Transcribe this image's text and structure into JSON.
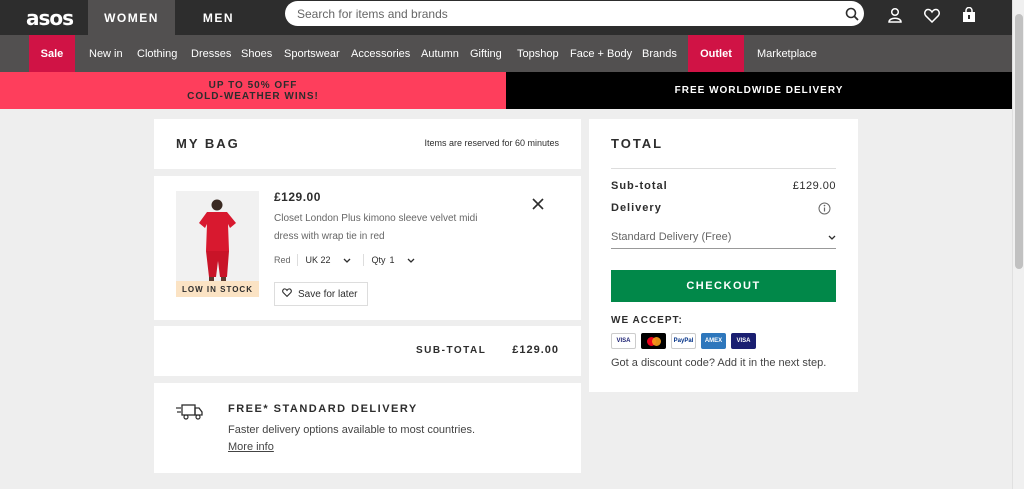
{
  "header": {
    "logo": "asos",
    "tabs": [
      {
        "label": "WOMEN"
      },
      {
        "label": "MEN"
      }
    ],
    "search": {
      "placeholder": "Search for items and brands"
    }
  },
  "nav": {
    "items": [
      {
        "label": "Sale",
        "highlight": true
      },
      {
        "label": "New in"
      },
      {
        "label": "Clothing"
      },
      {
        "label": "Dresses"
      },
      {
        "label": "Shoes"
      },
      {
        "label": "Sportswear"
      },
      {
        "label": "Accessories"
      },
      {
        "label": "Autumn"
      },
      {
        "label": "Gifting"
      },
      {
        "label": "Topshop"
      },
      {
        "label": "Face + Body"
      },
      {
        "label": "Brands"
      },
      {
        "label": "Outlet",
        "highlight": true
      },
      {
        "label": "Marketplace"
      }
    ]
  },
  "promo": {
    "left_line1": "UP TO 50% OFF",
    "left_line2": "COLD-WEATHER WINS!",
    "right": "FREE WORLDWIDE DELIVERY"
  },
  "bag": {
    "title": "MY BAG",
    "reserved_note": "Items are reserved for 60 minutes",
    "item": {
      "price": "£129.00",
      "name_line1": "Closet London Plus kimono sleeve velvet midi",
      "name_line2": "dress with wrap tie in red",
      "color": "Red",
      "size": "UK 22",
      "qty_label": "Qty",
      "qty": "1",
      "stock_badge": "LOW IN STOCK",
      "save_label": "Save for later"
    },
    "subtotal_label": "SUB-TOTAL",
    "subtotal_value": "£129.00"
  },
  "delivery_info": {
    "title": "FREE* STANDARD DELIVERY",
    "text": "Faster delivery options available to most countries.",
    "link": "More info"
  },
  "total": {
    "title": "TOTAL",
    "subtotal_label": "Sub-total",
    "subtotal_value": "£129.00",
    "delivery_label": "Delivery",
    "delivery_option": "Standard Delivery (Free)",
    "checkout_label": "CHECKOUT",
    "accept_label": "WE ACCEPT:",
    "payment_methods": [
      "VISA",
      "MC",
      "PayPal",
      "AMEX",
      "VISA"
    ],
    "discount_note": "Got a discount code? Add it in the next step."
  },
  "colors": {
    "dark": "#2d2d2d",
    "nav": "#525050",
    "sale": "#d01345",
    "promo_pink": "#fe3e5c",
    "checkout_green": "#018849"
  }
}
